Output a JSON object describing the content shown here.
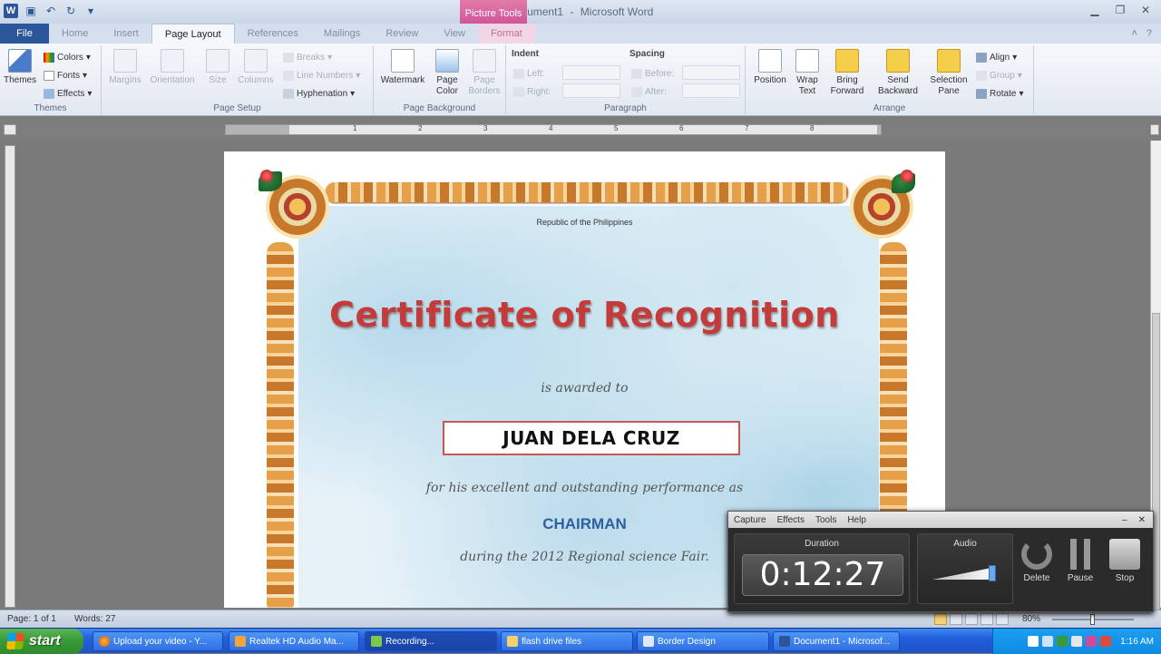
{
  "window": {
    "title_doc": "Document1",
    "title_sep": " - ",
    "title_app": "Microsoft Word",
    "context_tab_group": "Picture Tools"
  },
  "tabs": [
    "File",
    "Home",
    "Insert",
    "Page Layout",
    "References",
    "Mailings",
    "Review",
    "View",
    "Format"
  ],
  "ribbon": {
    "themes": {
      "themes": "Themes",
      "colors": "Colors",
      "fonts": "Fonts",
      "effects": "Effects",
      "label": "Themes"
    },
    "page_setup": {
      "margins": "Margins",
      "orientation": "Orientation",
      "size": "Size",
      "columns": "Columns",
      "breaks": "Breaks",
      "line_numbers": "Line Numbers",
      "hyphenation": "Hyphenation",
      "label": "Page Setup"
    },
    "page_background": {
      "watermark": "Watermark",
      "page_color_1": "Page",
      "page_color_2": "Color",
      "page_borders_1": "Page",
      "page_borders_2": "Borders",
      "label": "Page Background"
    },
    "paragraph": {
      "indent": "Indent",
      "left": "Left:",
      "right": "Right:",
      "spacing": "Spacing",
      "before": "Before:",
      "after": "After:",
      "label": "Paragraph"
    },
    "arrange": {
      "position": "Position",
      "wrap_1": "Wrap",
      "wrap_2": "Text",
      "bring_1": "Bring",
      "bring_2": "Forward",
      "send_1": "Send",
      "send_2": "Backward",
      "sel_1": "Selection",
      "sel_2": "Pane",
      "align": "Align",
      "group": "Group",
      "rotate": "Rotate",
      "label": "Arrange"
    }
  },
  "document": {
    "republic": "Republic of the Philippines",
    "title": "Certificate of Recognition",
    "awarded": "is awarded to",
    "name": "JUAN DELA CRUZ",
    "for_text": "for his excellent and outstanding performance as",
    "position": "CHAIRMAN",
    "during": "during the 2012 Regional science Fair."
  },
  "statusbar": {
    "page": "Page: 1 of 1",
    "words": "Words: 27",
    "zoom": "80%"
  },
  "recorder": {
    "menu": [
      "Capture",
      "Effects",
      "Tools",
      "Help"
    ],
    "duration_label": "Duration",
    "duration": "0:12:27",
    "audio_label": "Audio",
    "delete": "Delete",
    "pause": "Pause",
    "stop": "Stop"
  },
  "taskbar": {
    "start": "start",
    "tasks": [
      "Upload your video - Y...",
      "Realtek HD Audio Ma...",
      "Recording...",
      "flash drive files",
      "Border Design",
      "Document1 - Microsof..."
    ],
    "clock": "1:16 AM"
  },
  "colors": {
    "title_red": "#c43b3b",
    "position_blue": "#2e5fa2",
    "file_tab": "#2b579a",
    "picture_tools": "#d0559a"
  }
}
